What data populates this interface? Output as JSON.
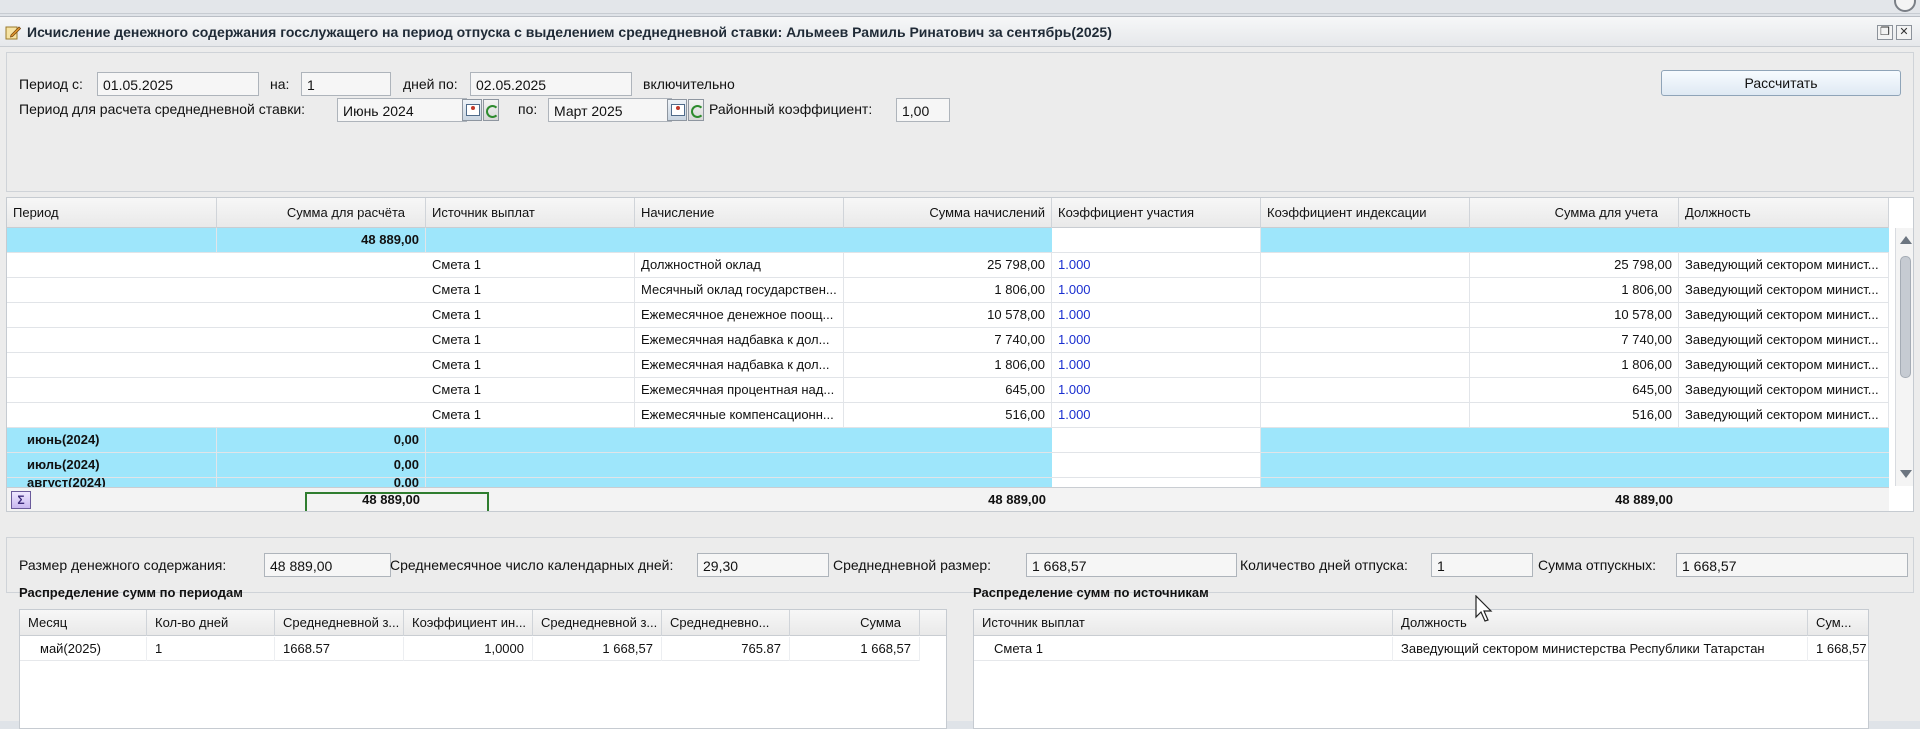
{
  "window": {
    "title": "Исчисление денежного содержания госслужащего на период отпуска с выделением среднедневной ставки: Альмеев Рамиль Ринатович за сентябрь(2025)"
  },
  "params": {
    "period_from_label": "Период с:",
    "period_from": "01.05.2025",
    "for_label": "на:",
    "days": "1",
    "days_to_label": "дней по:",
    "period_to": "02.05.2025",
    "inclusive": "включительно",
    "calc_period_label": "Период для расчета среднедневной ставки:",
    "calc_from": "Июнь 2024",
    "calc_to_label": "по:",
    "calc_to": "Март 2025",
    "district_label": "Районный коэффициент:",
    "district_coef": "1,00",
    "calculate_button": "Рассчитать"
  },
  "grid": {
    "columns": [
      "Период",
      "Сумма для расчёта",
      "Источник выплат",
      "Начисление",
      "Сумма начислений",
      "Коэффициент участия",
      "Коэффициент индексации",
      "Сумма для учета",
      "Должность"
    ],
    "group_total": {
      "period": "",
      "sum": "48 889,00"
    },
    "rows": [
      {
        "source": "Смета 1",
        "accrual": "Должностной оклад",
        "accrued": "25 798,00",
        "coef": "1.000",
        "for_account": "25 798,00",
        "position": "Заведующий сектором минист..."
      },
      {
        "source": "Смета 1",
        "accrual": "Месячный оклад государствен...",
        "accrued": "1 806,00",
        "coef": "1.000",
        "for_account": "1 806,00",
        "position": "Заведующий сектором минист..."
      },
      {
        "source": "Смета 1",
        "accrual": "Ежемесячное денежное поощ...",
        "accrued": "10 578,00",
        "coef": "1.000",
        "for_account": "10 578,00",
        "position": "Заведующий сектором минист..."
      },
      {
        "source": "Смета 1",
        "accrual": "Ежемесячная надбавка к дол...",
        "accrued": "7 740,00",
        "coef": "1.000",
        "for_account": "7 740,00",
        "position": "Заведующий сектором минист..."
      },
      {
        "source": "Смета 1",
        "accrual": "Ежемесячная надбавка к дол...",
        "accrued": "1 806,00",
        "coef": "1.000",
        "for_account": "1 806,00",
        "position": "Заведующий сектором минист..."
      },
      {
        "source": "Смета 1",
        "accrual": "Ежемесячная процентная над...",
        "accrued": "645,00",
        "coef": "1.000",
        "for_account": "645,00",
        "position": "Заведующий сектором минист..."
      },
      {
        "source": "Смета 1",
        "accrual": "Ежемесячные компенсационн...",
        "accrued": "516,00",
        "coef": "1.000",
        "for_account": "516,00",
        "position": "Заведующий сектором минист..."
      }
    ],
    "month_groups": [
      {
        "period": "июнь(2024)",
        "sum": "0,00"
      },
      {
        "period": "июль(2024)",
        "sum": "0,00"
      },
      {
        "period": "август(2024)",
        "sum": "0,00"
      }
    ],
    "footer": {
      "sum_for_calc": "48 889,00",
      "accrued_total": "48 889,00",
      "for_account_total": "48 889,00",
      "sigma": "Σ"
    }
  },
  "summary": {
    "salary_label": "Размер денежного содержания:",
    "salary": "48 889,00",
    "avg_days_label": "Среднемесячное число календарных дней:",
    "avg_days": "29,30",
    "daily_label": "Среднедневной размер:",
    "daily": "1 668,57",
    "vacation_days_label": "Количество дней отпуска:",
    "vacation_days": "1",
    "vacation_sum_label": "Сумма отпускных:",
    "vacation_sum": "1 668,57"
  },
  "by_period": {
    "title": "Распределение сумм по периодам",
    "columns": [
      "Месяц",
      "Кол-во дней",
      "Среднедневной з...",
      "Коэффициент ин...",
      "Среднедневной з...",
      "Среднедневно...",
      "Сумма"
    ],
    "rows": [
      [
        "май(2025)",
        "1",
        "1668.57",
        "1,0000",
        "1 668,57",
        "765.87",
        "1 668,57"
      ]
    ]
  },
  "by_source": {
    "title": "Распределение сумм по источникам",
    "columns": [
      "Источник выплат",
      "Должность",
      "Сум..."
    ],
    "rows": [
      [
        "Смета 1",
        "Заведующий сектором министерства Республики Татарстан",
        "1 668,57"
      ]
    ]
  }
}
